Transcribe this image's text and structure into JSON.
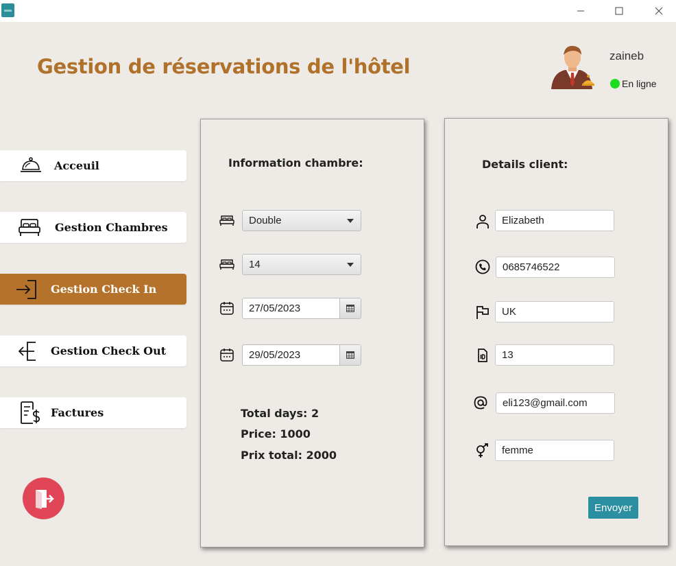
{
  "window": {
    "controls": {
      "minimize": "—",
      "maximize": "☐",
      "close": "✕"
    }
  },
  "header": {
    "title": "Gestion de réservations de l'hôtel",
    "user_name": "zaineb",
    "status": "En ligne",
    "status_color": "#1edc1e",
    "avatar_icon": "receptionist-avatar-icon"
  },
  "sidebar": {
    "items": [
      {
        "label": "Acceuil",
        "icon": "service-bell-icon",
        "active": false
      },
      {
        "label": "Gestion Chambres",
        "icon": "bed-icon",
        "active": false
      },
      {
        "label": "Gestion Check In",
        "icon": "login-icon",
        "active": true
      },
      {
        "label": "Gestion Check Out",
        "icon": "logout-arrow-icon",
        "active": false
      },
      {
        "label": "Factures",
        "icon": "invoice-dollar-icon",
        "active": false
      }
    ],
    "active_color": "#b5722a",
    "logout_icon": "exit-door-icon",
    "logout_color": "#e04657"
  },
  "room_panel": {
    "heading": "Information chambre:",
    "room_type": "Double",
    "room_number": "14",
    "check_in_date": "27/05/2023",
    "check_out_date": "29/05/2023",
    "total_days": "Total days: 2",
    "price": "Price: 1000",
    "total_price": "Prix total: 2000"
  },
  "client_panel": {
    "heading": "Details client:",
    "name": "Elizabeth",
    "phone": "0685746522",
    "country": "UK",
    "id": "13",
    "email": "eli123@gmail.com",
    "gender": "femme",
    "submit_label": "Envoyer",
    "submit_color": "#2a8fa1"
  }
}
